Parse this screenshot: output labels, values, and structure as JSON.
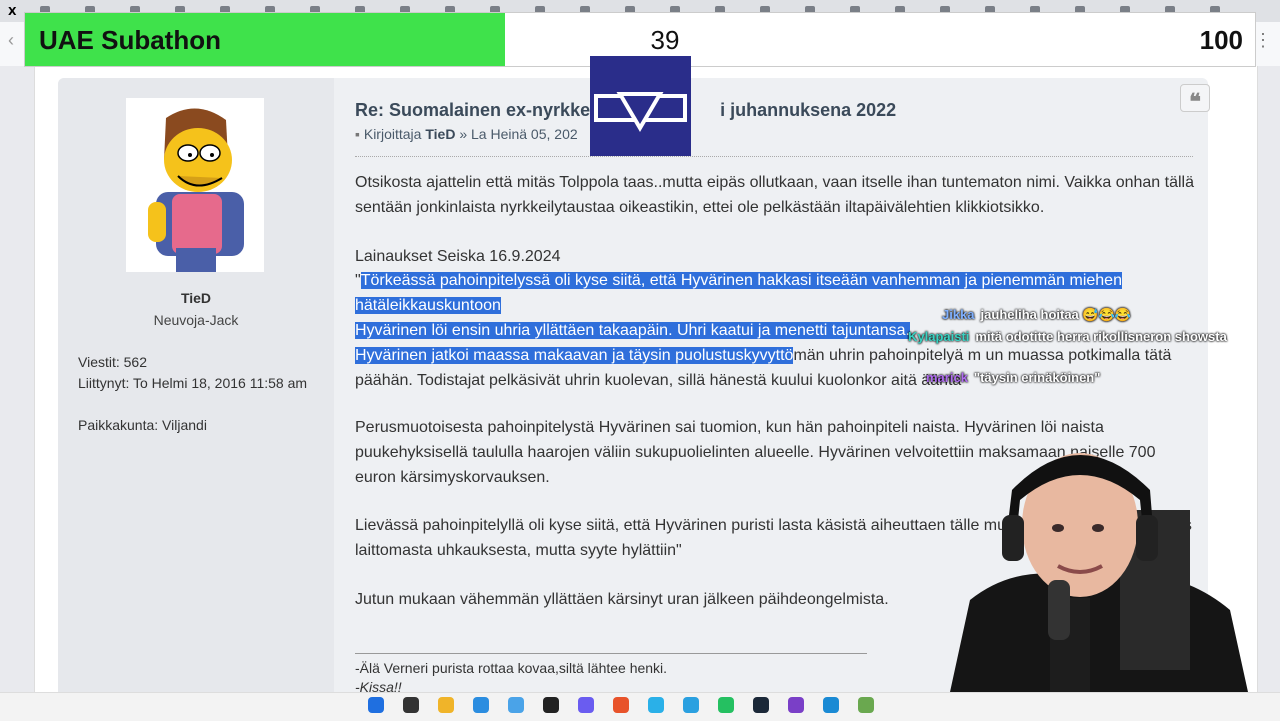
{
  "subathon": {
    "title": "UAE Subathon",
    "current": "39",
    "goal": "100",
    "progress": 0.39,
    "fill_color": "#3fe24b"
  },
  "post": {
    "title": "Re: Suomalainen ex-nyrkke",
    "title_end": "i juhannuksena 2022",
    "byline_prefix": "Kirjoittaja",
    "author": "TieD",
    "date": "» La Heinä 05, 202"
  },
  "profile": {
    "username": "TieD",
    "rank": "Neuvoja-Jack",
    "posts": "Viestit: 562",
    "joined": "Liittynyt: To Helmi 18, 2016 11:58 am",
    "location": "Paikkakunta: Viljandi"
  },
  "body": {
    "p1": "Otsikosta ajattelin että mitäs Tolppola taas..mutta eipäs ollutkaan, vaan itselle ihan tuntematon nimi. Vaikka onhan tällä sentään jonkinlaista nyrkkeilytaustaa oikeastikin, ettei ole pelkästään iltapäivälehtien klikkiotsikko.",
    "quote_source": "Lainaukset Seiska 16.9.2024",
    "quote_open": "\"",
    "hl1": "Törkeässä pahoinpitelyssä oli kyse siitä, että Hyvärinen hakkasi itseään vanhemman ja pienemmän miehen hätäleikkauskuntoon",
    "hl2": "Hyvärinen löi ensin uhria yllättäen takaapäin. Uhri kaatui ja menetti tajuntansa.",
    "hl3": "Hyvärinen jatkoi maassa makaavan ja täysin puolustuskyvyttö",
    "q_rest": "män uhrin pahoinpitelyä m  un muassa potkimalla tätä päähän. Todistajat pelkäsivät uhrin kuolevan, sillä hänestä kuului kuolonkor  aitä ääntä",
    "p3": "Perusmuotoisesta pahoinpitelystä Hyvärinen sai tuomion, kun hän pahoinpiteli naista. Hyvärinen löi naista puukehyksisellä taululla haarojen väliin sukupuolielinten alueelle. Hyvärinen velvoitettiin maksamaan naiselle 700 euron kärsimyskorvauksen.",
    "p4": "Lievässä pahoinpitelyllä oli kyse siitä, että Hyvärinen puristi lasta käsistä aiheuttaen tälle mus  ja. Häntä syytettiin myös laittomasta uhkauksesta, mutta syyte hylättiin\"",
    "p5": "Jutun mukaan vähemmän yllättäen kärsinyt uran jälkeen päihdeongelmista.",
    "sig1": "-Älä Verneri purista rottaa kovaa,siltä lähtee henki.",
    "sig2": "-Kissa!!"
  },
  "chat": [
    {
      "user": "Jikka",
      "msg": "jauheliha hoitaa 😅😂😂",
      "color": "#7fb0ff"
    },
    {
      "user": "Kylapaisti",
      "msg": "mitä odotitte herra rikollisneron showsta",
      "color": "#39d3c3"
    },
    {
      "user": "marick",
      "msg": "\"täysin erinäköinen\"",
      "color": "#b06cf0"
    }
  ],
  "colors": {
    "highlight": "#2f6fdb",
    "post_bg": "#eef0f3",
    "profile_bg": "#e6e8ec"
  },
  "icons": [
    "windows-start-icon",
    "search-icon",
    "file-explorer-icon",
    "edge-icon",
    "store-icon",
    "terminal-icon",
    "discord-icon",
    "brave-icon",
    "chrome-icon",
    "telegram-icon",
    "whatsapp-icon",
    "steam-icon",
    "visual-studio-icon",
    "vscode-icon",
    "app-icon"
  ]
}
